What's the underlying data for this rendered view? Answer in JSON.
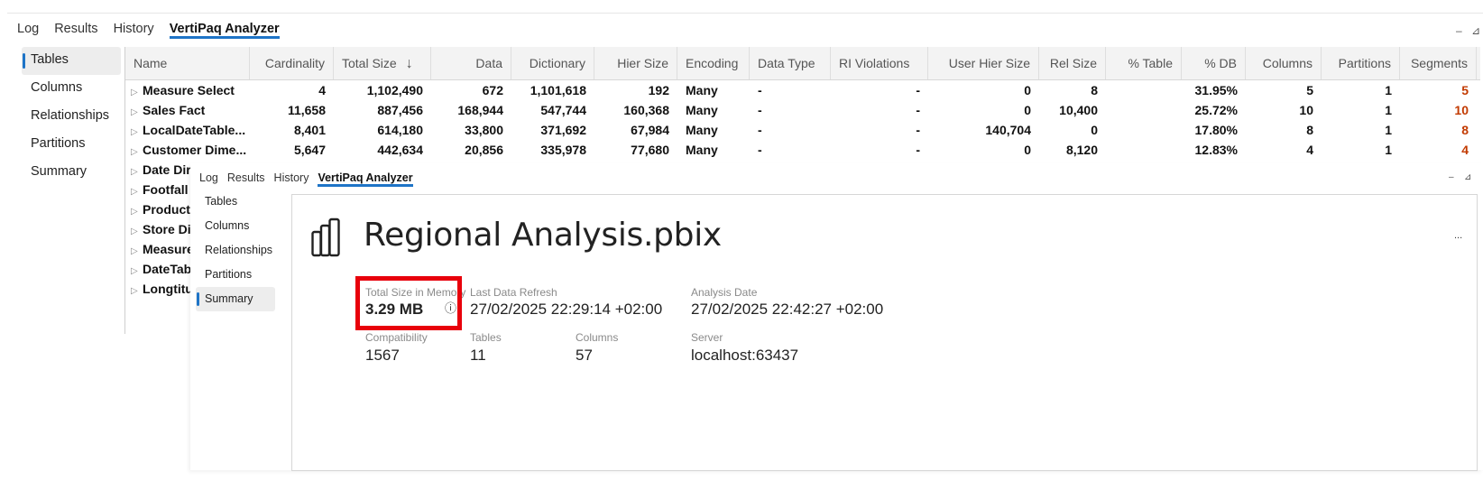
{
  "back_window": {
    "tabs": [
      "Log",
      "Results",
      "History",
      "VertiPaq Analyzer"
    ],
    "active_tab": "VertiPaq Analyzer",
    "window_controls": {
      "minimize": "–",
      "pin": "⊿"
    },
    "nav_items": [
      "Tables",
      "Columns",
      "Relationships",
      "Partitions",
      "Summary"
    ],
    "active_nav": "Tables",
    "grid": {
      "columns": [
        {
          "label": "Name",
          "sort": ""
        },
        {
          "label": "Cardinality",
          "sort": ""
        },
        {
          "label": "Total Size",
          "sort": "↓"
        },
        {
          "label": "Data",
          "sort": ""
        },
        {
          "label": "Dictionary",
          "sort": ""
        },
        {
          "label": "Hier Size",
          "sort": ""
        },
        {
          "label": "Encoding",
          "sort": ""
        },
        {
          "label": "Data Type",
          "sort": ""
        },
        {
          "label": "RI Violations",
          "sort": ""
        },
        {
          "label": "User Hier Size",
          "sort": ""
        },
        {
          "label": "Rel Size",
          "sort": ""
        },
        {
          "label": "% Table",
          "sort": ""
        },
        {
          "label": "% DB",
          "sort": ""
        },
        {
          "label": "Columns",
          "sort": ""
        },
        {
          "label": "Partitions",
          "sort": ""
        },
        {
          "label": "Segments",
          "sort": ""
        }
      ],
      "rows": [
        [
          "Measure Select",
          "4",
          "1,102,490",
          "672",
          "1,101,618",
          "192",
          "Many",
          "-",
          "-",
          "0",
          "8",
          "",
          "31.95%",
          "5",
          "1",
          "5"
        ],
        [
          "Sales Fact",
          "11,658",
          "887,456",
          "168,944",
          "547,744",
          "160,368",
          "Many",
          "-",
          "-",
          "0",
          "10,400",
          "",
          "25.72%",
          "10",
          "1",
          "10"
        ],
        [
          "LocalDateTable...",
          "8,401",
          "614,180",
          "33,800",
          "371,692",
          "67,984",
          "Many",
          "-",
          "-",
          "140,704",
          "0",
          "",
          "17.80%",
          "8",
          "1",
          "8"
        ],
        [
          "Customer Dime...",
          "5,647",
          "442,634",
          "20,856",
          "335,978",
          "77,680",
          "Many",
          "-",
          "-",
          "0",
          "8,120",
          "",
          "12.83%",
          "4",
          "1",
          "4"
        ]
      ],
      "partial_rows": [
        "Date Dir",
        "Footfall",
        "Product",
        "Store Di",
        "Measure",
        "DateTab",
        "Longtitu"
      ]
    }
  },
  "front_window": {
    "tabs": [
      "Log",
      "Results",
      "History",
      "VertiPaq Analyzer"
    ],
    "active_tab": "VertiPaq Analyzer",
    "window_controls": {
      "minimize": "–",
      "pin": "⊿"
    },
    "nav_items": [
      "Tables",
      "Columns",
      "Relationships",
      "Partitions",
      "Summary"
    ],
    "active_nav": "Summary",
    "summary": {
      "title": "Regional Analysis.pbix",
      "more": "...",
      "stats": {
        "total_size": {
          "label": "Total Size in Memory",
          "value": "3.29 MB"
        },
        "last_refresh": {
          "label": "Last Data Refresh",
          "value": "27/02/2025 22:29:14 +02:00"
        },
        "analysis_date": {
          "label": "Analysis Date",
          "value": "27/02/2025 22:42:27 +02:00"
        },
        "compatibility": {
          "label": "Compatibility",
          "value": "1567"
        },
        "tables": {
          "label": "Tables",
          "value": "11"
        },
        "columns": {
          "label": "Columns",
          "value": "57"
        },
        "server": {
          "label": "Server",
          "value": "localhost:63437"
        }
      },
      "info_glyph": "ⓘ"
    }
  },
  "highlight_color": "#e8000b",
  "accent_color": "#1e74c7"
}
